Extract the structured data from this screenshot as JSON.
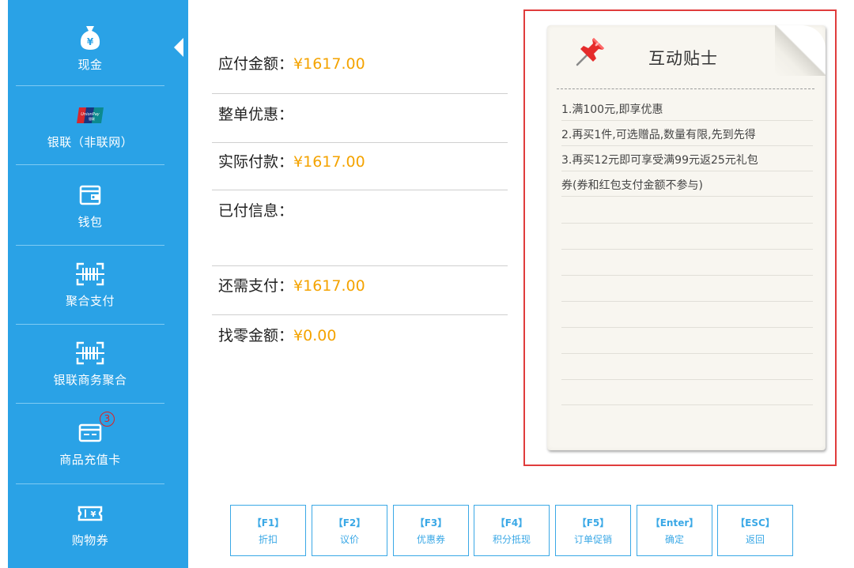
{
  "sidebar": {
    "items": [
      {
        "label": "现金",
        "icon": "money-bag-icon",
        "badge": ""
      },
      {
        "label": "银联（非联网）",
        "icon": "unionpay-logo-icon",
        "badge": ""
      },
      {
        "label": "钱包",
        "icon": "wallet-icon",
        "badge": ""
      },
      {
        "label": "聚合支付",
        "icon": "barcode-scan-icon",
        "badge": ""
      },
      {
        "label": "银联商务聚合",
        "icon": "barcode-scan-icon",
        "badge": ""
      },
      {
        "label": "商品充值卡",
        "icon": "card-icon",
        "badge": "3"
      },
      {
        "label": "购物券",
        "icon": "coupon-icon",
        "badge": ""
      }
    ],
    "active_index": 0,
    "cash_icon_symbol": "¥",
    "coupon_icon_symbol": "¥",
    "unionpay_logo_text": "UnionPay",
    "unionpay_logo_sub": "银联"
  },
  "payment": {
    "payable_label": "应付金额：",
    "payable_value": "¥1617.00",
    "discount_label": "整单优惠：",
    "discount_value": "",
    "actual_label": "实际付款：",
    "actual_value": "¥1617.00",
    "paid_info_label": "已付信息：",
    "paid_info_value": "",
    "remaining_label": "还需支付：",
    "remaining_value": "¥1617.00",
    "change_label": "找零金额：",
    "change_value": "¥0.00"
  },
  "notes": {
    "title": "互动贴士",
    "lines": [
      "1.满100元,即享优惠",
      "2.再买1件,可选赠品,数量有限,先到先得",
      "3.再买12元即可享受满99元返25元礼包",
      "券(券和红包支付金额不参与)"
    ]
  },
  "function_keys": [
    {
      "key": "【F1】",
      "name": "折扣"
    },
    {
      "key": "【F2】",
      "name": "议价"
    },
    {
      "key": "【F3】",
      "name": "优惠券"
    },
    {
      "key": "【F4】",
      "name": "积分抵现"
    },
    {
      "key": "【F5】",
      "name": "订单促销"
    },
    {
      "key": "【Enter】",
      "name": "确定"
    },
    {
      "key": "【ESC】",
      "name": "返回"
    }
  ],
  "colors": {
    "sidebar_bg": "#2aa2e6",
    "amount_value": "#f4a300",
    "notes_border": "#e03c3c",
    "fkey_accent": "#3aa8e6"
  }
}
